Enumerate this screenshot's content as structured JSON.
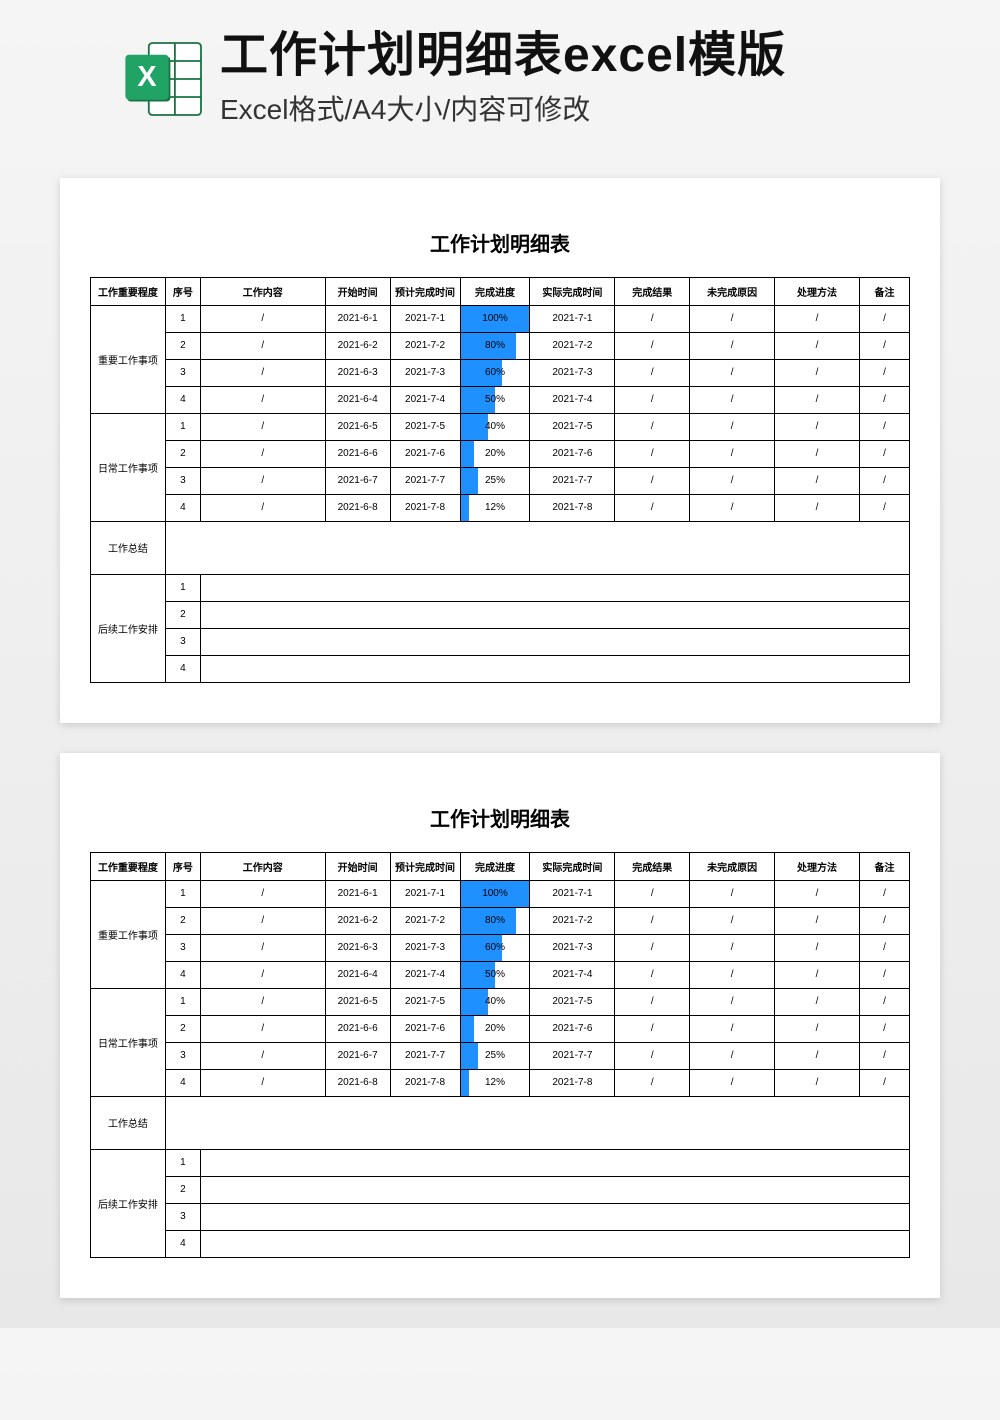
{
  "header": {
    "title": "工作计划明细表excel模版",
    "subtitle": "Excel格式/A4大小/内容可修改"
  },
  "sheet": {
    "title": "工作计划明细表",
    "headers": [
      "工作重要程度",
      "序号",
      "工作内容",
      "开始时间",
      "预计完成时间",
      "完成进度",
      "实际完成时间",
      "完成结果",
      "未完成原因",
      "处理方法",
      "备注"
    ],
    "groups": [
      {
        "category": "重要工作事项",
        "rows": [
          {
            "seq": "1",
            "content": "/",
            "start": "2021-6-1",
            "est": "2021-7-1",
            "progress": 100,
            "actual": "2021-7-1",
            "result": "/",
            "reason": "/",
            "method": "/",
            "remark": "/"
          },
          {
            "seq": "2",
            "content": "/",
            "start": "2021-6-2",
            "est": "2021-7-2",
            "progress": 80,
            "actual": "2021-7-2",
            "result": "/",
            "reason": "/",
            "method": "/",
            "remark": "/"
          },
          {
            "seq": "3",
            "content": "/",
            "start": "2021-6-3",
            "est": "2021-7-3",
            "progress": 60,
            "actual": "2021-7-3",
            "result": "/",
            "reason": "/",
            "method": "/",
            "remark": "/"
          },
          {
            "seq": "4",
            "content": "/",
            "start": "2021-6-4",
            "est": "2021-7-4",
            "progress": 50,
            "actual": "2021-7-4",
            "result": "/",
            "reason": "/",
            "method": "/",
            "remark": "/"
          }
        ]
      },
      {
        "category": "日常工作事项",
        "rows": [
          {
            "seq": "1",
            "content": "/",
            "start": "2021-6-5",
            "est": "2021-7-5",
            "progress": 40,
            "actual": "2021-7-5",
            "result": "/",
            "reason": "/",
            "method": "/",
            "remark": "/"
          },
          {
            "seq": "2",
            "content": "/",
            "start": "2021-6-6",
            "est": "2021-7-6",
            "progress": 20,
            "actual": "2021-7-6",
            "result": "/",
            "reason": "/",
            "method": "/",
            "remark": "/"
          },
          {
            "seq": "3",
            "content": "/",
            "start": "2021-6-7",
            "est": "2021-7-7",
            "progress": 25,
            "actual": "2021-7-7",
            "result": "/",
            "reason": "/",
            "method": "/",
            "remark": "/"
          },
          {
            "seq": "4",
            "content": "/",
            "start": "2021-6-8",
            "est": "2021-7-8",
            "progress": 12,
            "actual": "2021-7-8",
            "result": "/",
            "reason": "/",
            "method": "/",
            "remark": "/"
          }
        ]
      }
    ],
    "summary_label": "工作总结",
    "followup_label": "后续工作安排",
    "followup_rows": [
      "1",
      "2",
      "3",
      "4"
    ]
  }
}
